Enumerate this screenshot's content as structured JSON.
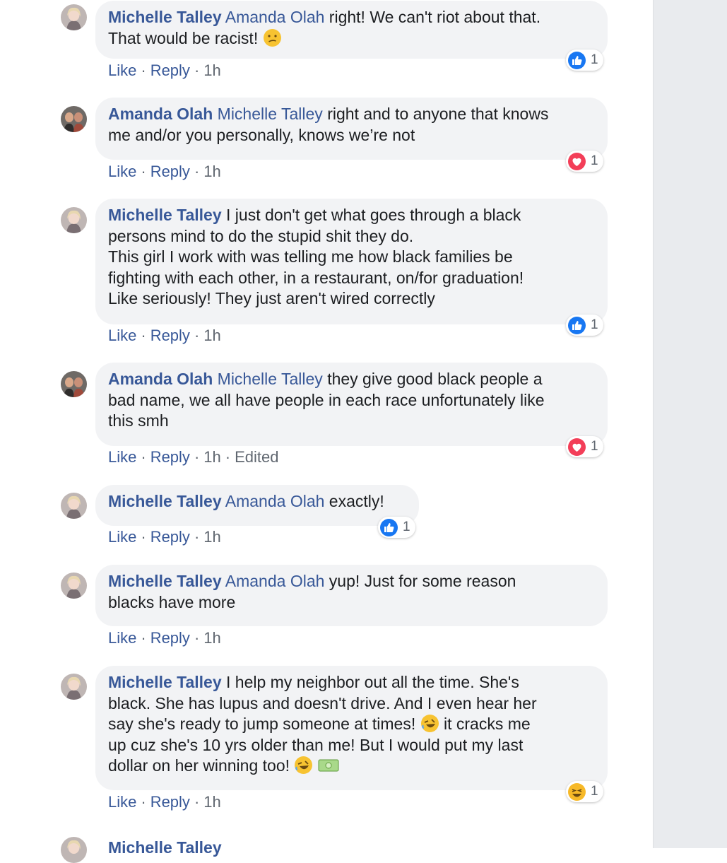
{
  "comments": [
    {
      "author": "Michelle Talley",
      "mention": "Amanda Olah",
      "text": "right! We can't riot about that.",
      "text2": "That would be racist!",
      "reaction_icon": "like-icon",
      "reaction_count": "1",
      "like": "Like",
      "reply": "Reply",
      "time": "1h"
    },
    {
      "author": "Amanda Olah",
      "mention": "Michelle Talley",
      "text": "right and to anyone that knows",
      "text2": "me and/or you personally, knows we’re not",
      "reaction_icon": "love-icon",
      "reaction_count": "1",
      "like": "Like",
      "reply": "Reply",
      "time": "1h"
    },
    {
      "author": "Michelle Talley",
      "line1": "I just don't get what goes through a black",
      "line2": "persons mind to do the stupid shit they do.",
      "line3": "This girl I work with was telling me how black families be",
      "line4": "fighting with each other, in a restaurant, on/for graduation!",
      "line5": "Like seriously! They just aren't wired correctly",
      "reaction_icon": "like-icon",
      "reaction_count": "1",
      "like": "Like",
      "reply": "Reply",
      "time": "1h"
    },
    {
      "author": "Amanda Olah",
      "mention": "Michelle Talley",
      "line1": "they give good black people a",
      "line2": "bad name, we all have people in each race unfortunately like",
      "line3": "this smh",
      "reaction_icon": "love-icon",
      "reaction_count": "1",
      "like": "Like",
      "reply": "Reply",
      "time": "1h",
      "edited": "Edited"
    },
    {
      "author": "Michelle Talley",
      "mention": "Amanda Olah",
      "text": "exactly!",
      "reaction_icon": "like-icon",
      "reaction_count": "1",
      "like": "Like",
      "reply": "Reply",
      "time": "1h"
    },
    {
      "author": "Michelle Talley",
      "mention": "Amanda Olah",
      "line1": "yup! Just for some reason",
      "line2": "blacks have more",
      "like": "Like",
      "reply": "Reply",
      "time": "1h"
    },
    {
      "author": "Michelle Talley",
      "line1": "I help my neighbor out all the time. She's",
      "line2": "black. She has lupus and doesn't drive. And I even hear her",
      "line3": "say she's ready to jump someone at times!",
      "line4": "it cracks me",
      "line5": "up cuz she's 10 yrs older than me! But I would put my last",
      "line6": "dollar on her winning too!",
      "reaction_icon": "haha-icon",
      "reaction_count": "1",
      "like": "Like",
      "reply": "Reply",
      "time": "1h"
    }
  ],
  "partial_next_author": "Michelle Talley",
  "colors": {
    "link": "#385898",
    "bubble": "#f2f3f5",
    "like_blue": "#1877f2",
    "love_red": "#f33e58",
    "haha_yellow": "#f7b928",
    "sidebar": "#e9ebee"
  }
}
